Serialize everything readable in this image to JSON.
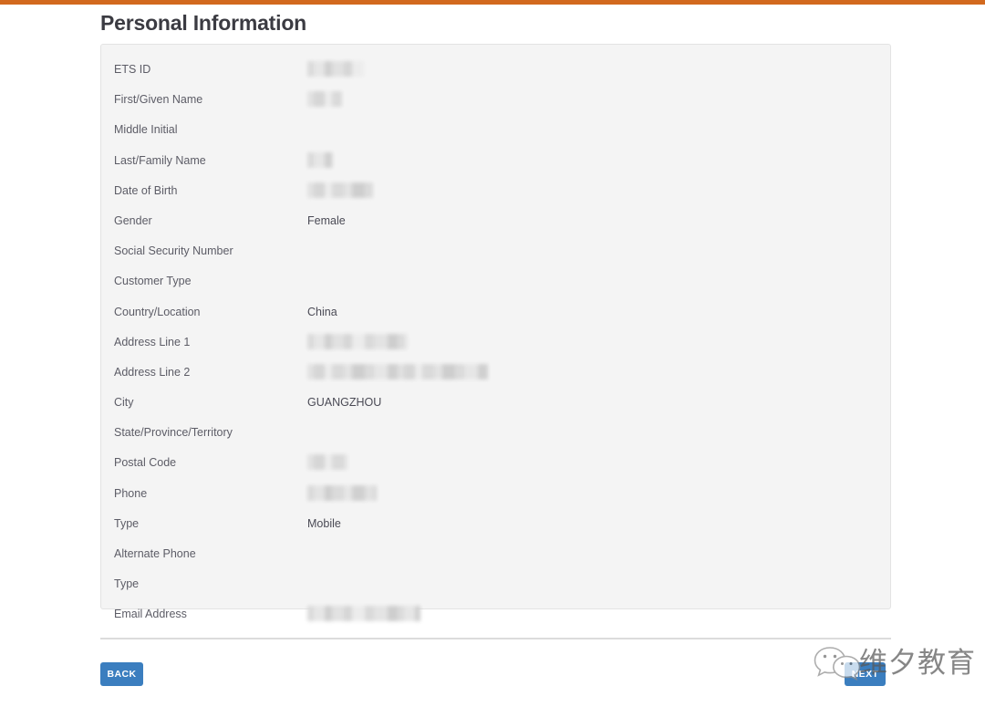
{
  "page": {
    "title": "Personal Information",
    "accent_color": "#d2691e",
    "panel_bg": "#f4f4f4",
    "button_color": "#3b7ebf"
  },
  "fields": [
    {
      "label": "ETS ID",
      "value": "",
      "redacted": true,
      "redact_width": 62
    },
    {
      "label": "First/Given Name",
      "value": "",
      "redacted": true,
      "redact_width": 38
    },
    {
      "label": "Middle Initial",
      "value": "",
      "redacted": false,
      "redact_width": 0
    },
    {
      "label": "Last/Family Name",
      "value": "",
      "redacted": true,
      "redact_width": 28
    },
    {
      "label": "Date of Birth",
      "value": "",
      "redacted": true,
      "redact_width": 72
    },
    {
      "label": "Gender",
      "value": "Female",
      "redacted": false,
      "redact_width": 0
    },
    {
      "label": "Social Security Number",
      "value": "",
      "redacted": false,
      "redact_width": 0
    },
    {
      "label": "Customer Type",
      "value": "",
      "redacted": false,
      "redact_width": 0
    },
    {
      "label": "Country/Location",
      "value": "China",
      "redacted": false,
      "redact_width": 0
    },
    {
      "label": "Address Line 1",
      "value": "",
      "redacted": true,
      "redact_width": 110
    },
    {
      "label": "Address Line 2",
      "value": "",
      "redacted": true,
      "redact_width": 198
    },
    {
      "label": "City",
      "value": "GUANGZHOU",
      "redacted": false,
      "redact_width": 0
    },
    {
      "label": "State/Province/Territory",
      "value": "",
      "redacted": false,
      "redact_width": 0
    },
    {
      "label": "Postal Code",
      "value": "",
      "redacted": true,
      "redact_width": 44
    },
    {
      "label": "Phone",
      "value": "",
      "redacted": true,
      "redact_width": 76
    },
    {
      "label": "Type",
      "value": "Mobile",
      "redacted": false,
      "redact_width": 0
    },
    {
      "label": "Alternate Phone",
      "value": "",
      "redacted": false,
      "redact_width": 0
    },
    {
      "label": "Type",
      "value": "",
      "redacted": false,
      "redact_width": 0
    },
    {
      "label": "Email Address",
      "value": "",
      "redacted": true,
      "redact_width": 124
    }
  ],
  "footer": {
    "back_label": "BACK",
    "next_label": "NEXT"
  },
  "watermark": {
    "icon": "wechat-icon",
    "text": "维夕教育"
  }
}
